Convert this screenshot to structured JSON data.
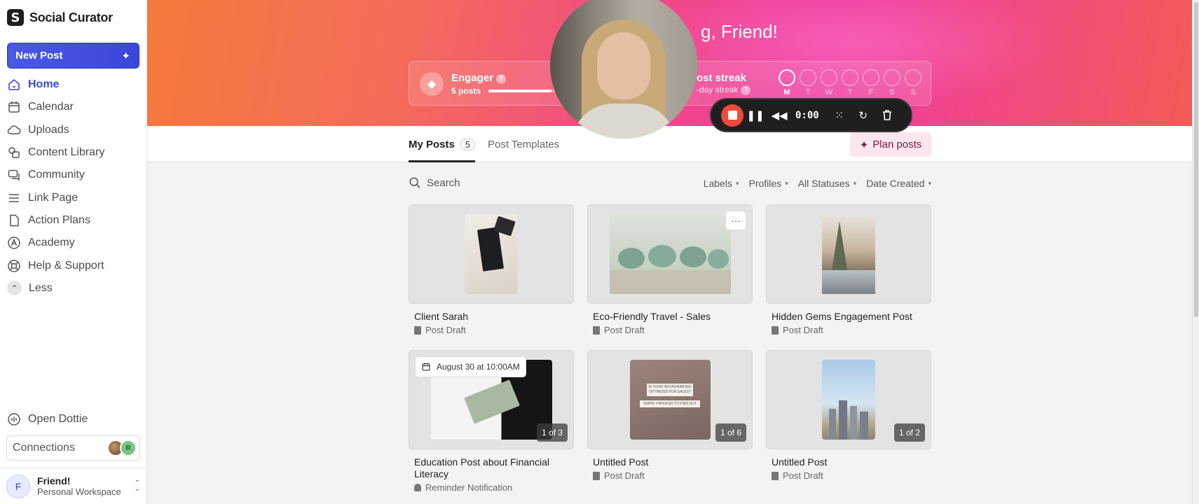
{
  "app": {
    "name": "Social Curator"
  },
  "sidebar": {
    "new_post": "New Post",
    "items": [
      {
        "label": "Home",
        "icon": "home-icon",
        "active": true
      },
      {
        "label": "Calendar",
        "icon": "calendar-icon"
      },
      {
        "label": "Uploads",
        "icon": "cloud-icon"
      },
      {
        "label": "Content Library",
        "icon": "library-icon"
      },
      {
        "label": "Community",
        "icon": "chat-icon"
      },
      {
        "label": "Link Page",
        "icon": "list-icon"
      },
      {
        "label": "Action Plans",
        "icon": "document-icon"
      },
      {
        "label": "Academy",
        "icon": "academy-icon"
      },
      {
        "label": "Help & Support",
        "icon": "lifebuoy-icon"
      },
      {
        "label": "Less",
        "icon": "chevron-up-icon"
      }
    ],
    "dottie": "Open Dottie",
    "connections": "Connections",
    "user": {
      "initial": "F",
      "name": "Friend!",
      "workspace": "Personal Workspace"
    }
  },
  "hero": {
    "greeting": "g, Friend!",
    "engager": {
      "title": "Engager",
      "sub": "5 posts",
      "progress": 0.75
    },
    "streak": {
      "title": "ost streak",
      "sub": "-day streak",
      "days": [
        "M",
        "T",
        "W",
        "T",
        "F",
        "S",
        "S"
      ],
      "active_index": 0
    },
    "accent": "#f0468a"
  },
  "tabs": {
    "my_posts": "My Posts",
    "my_posts_count": "5",
    "templates": "Post Templates",
    "plan": "Plan posts"
  },
  "filters": {
    "search_placeholder": "Search",
    "labels": "Labels",
    "profiles": "Profiles",
    "statuses": "All Statuses",
    "sort": "Date Created"
  },
  "posts": [
    {
      "title": "Client Sarah",
      "status": "Post Draft"
    },
    {
      "title": "Eco-Friendly Travel - Sales",
      "status": "Post Draft"
    },
    {
      "title": "Hidden Gems Engagement Post",
      "status": "Post Draft"
    },
    {
      "title": "Education Post about Financial Literacy",
      "status": "Reminder Notification",
      "date": "August 30 at 10:00AM",
      "count": "1 of 3"
    },
    {
      "title": "Untitled Post",
      "status": "Post Draft",
      "count": "1 of 6",
      "img_line1": "IS YOUR INSTAGRAM BIO OPTIMIZED FOR SALES?",
      "img_line2": "SWIPE THROUGH TO FIND OUT"
    },
    {
      "title": "Untitled Post",
      "status": "Post Draft",
      "count": "1 of 2"
    }
  ],
  "recorder": {
    "time": "0:00",
    "stop_color": "#ee4a3a"
  }
}
